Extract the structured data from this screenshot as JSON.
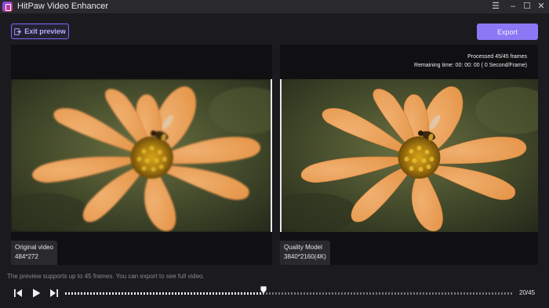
{
  "app": {
    "title": "HitPaw Video Enhancer"
  },
  "window_controls": {
    "menu": "☰",
    "minimize": "–",
    "maximize": "☐",
    "close": "✕"
  },
  "toolbar": {
    "exit_label": "Exit preview",
    "export_label": "Export"
  },
  "left_panel": {
    "title": "Original video",
    "resolution": "484*272"
  },
  "right_panel": {
    "title": "Quality Model",
    "resolution": "3840*2160(4K)",
    "processed": "Processed 45/45 frames",
    "remaining": "Remaining time: 00: 00: 00 ( 0 Second/Frame)"
  },
  "note": "The preview supports up to 45 frames. You can export to see full video.",
  "player": {
    "counter": "20/45",
    "current_frame": 20,
    "total_frames": 45
  },
  "colors": {
    "accent": "#8c78f5",
    "background": "#1b1b1f"
  },
  "icons": [
    "app-logo-icon",
    "exit-icon",
    "prev-frame-icon",
    "play-icon",
    "next-frame-icon",
    "slider-handle-icon"
  ]
}
